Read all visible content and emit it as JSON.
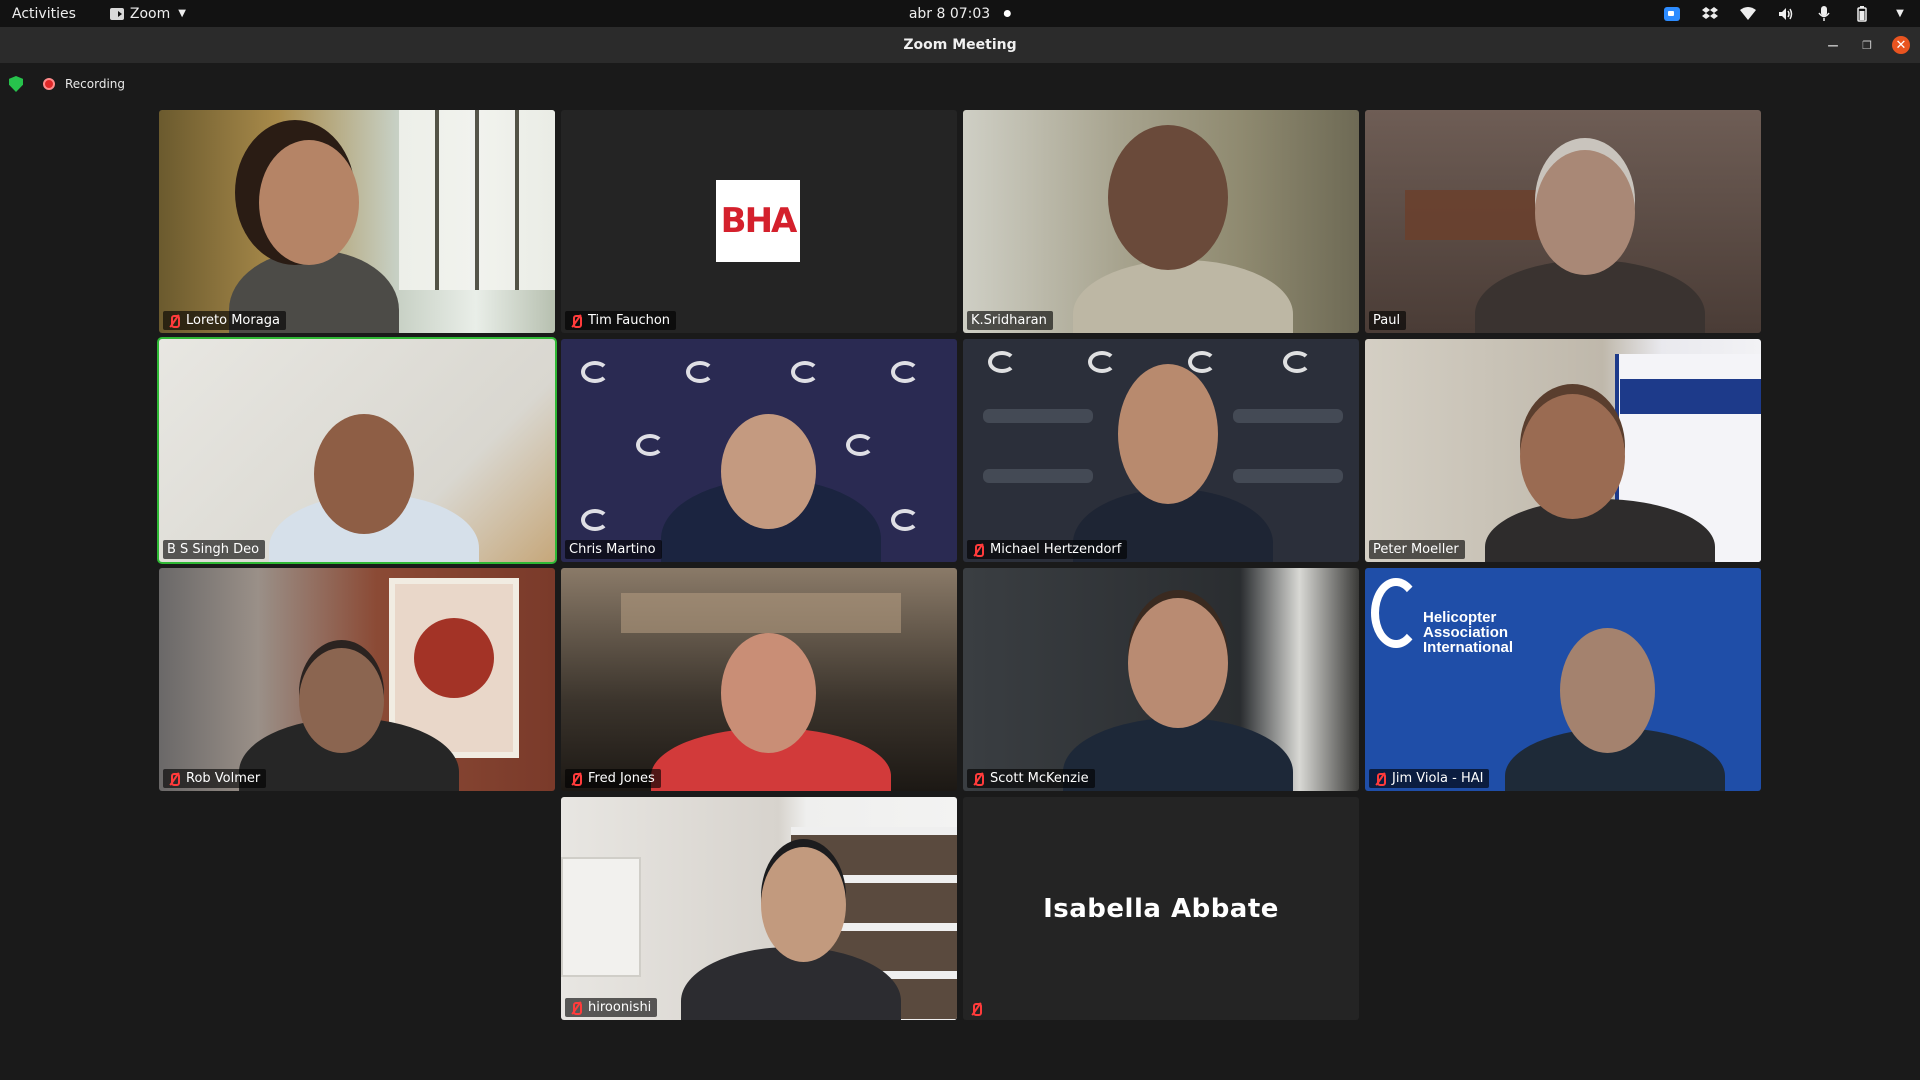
{
  "topbar": {
    "activities": "Activities",
    "app_name": "Zoom",
    "datetime": "abr 8  07:03"
  },
  "window": {
    "title": "Zoom Meeting"
  },
  "status": {
    "recording_label": "Recording"
  },
  "participants": [
    {
      "name": "Loreto Moraga",
      "muted": true
    },
    {
      "name": "Tim Fauchon",
      "muted": true
    },
    {
      "name": "K.Sridharan",
      "muted": false
    },
    {
      "name": "Paul",
      "muted": false
    },
    {
      "name": "B S Singh Deo",
      "muted": false,
      "speaking": true
    },
    {
      "name": "Chris Martino",
      "muted": false
    },
    {
      "name": "Michael Hertzendorf",
      "muted": true
    },
    {
      "name": "Peter Moeller",
      "muted": false
    },
    {
      "name": "Rob Volmer",
      "muted": true
    },
    {
      "name": "Fred Jones",
      "muted": true
    },
    {
      "name": "Scott McKenzie",
      "muted": true
    },
    {
      "name": "Jim Viola - HAI",
      "muted": true
    },
    {
      "name": "hiroonishi",
      "muted": true
    },
    {
      "name": "Isabella Abbate",
      "muted": true,
      "video_off": true
    }
  ],
  "logos": {
    "bha": "BHA",
    "hai_line1": "Helicopter",
    "hai_line2": "Association",
    "hai_line3": "International"
  },
  "colors": {
    "speaking_border": "#2fb835",
    "mute_red": "#ff3b3b",
    "record_red": "#e02828",
    "shield_green": "#27c24c"
  }
}
